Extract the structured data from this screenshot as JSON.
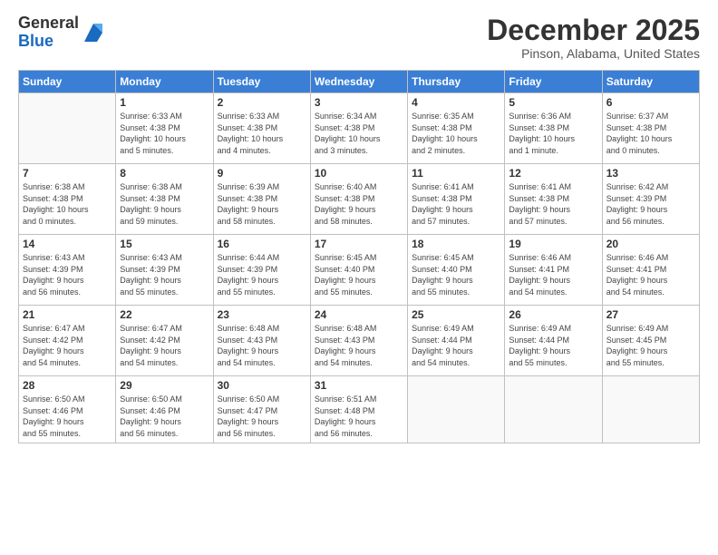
{
  "header": {
    "logo_general": "General",
    "logo_blue": "Blue",
    "month_title": "December 2025",
    "location": "Pinson, Alabama, United States"
  },
  "weekdays": [
    "Sunday",
    "Monday",
    "Tuesday",
    "Wednesday",
    "Thursday",
    "Friday",
    "Saturday"
  ],
  "weeks": [
    [
      {
        "day": "",
        "info": ""
      },
      {
        "day": "1",
        "info": "Sunrise: 6:33 AM\nSunset: 4:38 PM\nDaylight: 10 hours\nand 5 minutes."
      },
      {
        "day": "2",
        "info": "Sunrise: 6:33 AM\nSunset: 4:38 PM\nDaylight: 10 hours\nand 4 minutes."
      },
      {
        "day": "3",
        "info": "Sunrise: 6:34 AM\nSunset: 4:38 PM\nDaylight: 10 hours\nand 3 minutes."
      },
      {
        "day": "4",
        "info": "Sunrise: 6:35 AM\nSunset: 4:38 PM\nDaylight: 10 hours\nand 2 minutes."
      },
      {
        "day": "5",
        "info": "Sunrise: 6:36 AM\nSunset: 4:38 PM\nDaylight: 10 hours\nand 1 minute."
      },
      {
        "day": "6",
        "info": "Sunrise: 6:37 AM\nSunset: 4:38 PM\nDaylight: 10 hours\nand 0 minutes."
      }
    ],
    [
      {
        "day": "7",
        "info": "Sunrise: 6:38 AM\nSunset: 4:38 PM\nDaylight: 10 hours\nand 0 minutes."
      },
      {
        "day": "8",
        "info": "Sunrise: 6:38 AM\nSunset: 4:38 PM\nDaylight: 9 hours\nand 59 minutes."
      },
      {
        "day": "9",
        "info": "Sunrise: 6:39 AM\nSunset: 4:38 PM\nDaylight: 9 hours\nand 58 minutes."
      },
      {
        "day": "10",
        "info": "Sunrise: 6:40 AM\nSunset: 4:38 PM\nDaylight: 9 hours\nand 58 minutes."
      },
      {
        "day": "11",
        "info": "Sunrise: 6:41 AM\nSunset: 4:38 PM\nDaylight: 9 hours\nand 57 minutes."
      },
      {
        "day": "12",
        "info": "Sunrise: 6:41 AM\nSunset: 4:38 PM\nDaylight: 9 hours\nand 57 minutes."
      },
      {
        "day": "13",
        "info": "Sunrise: 6:42 AM\nSunset: 4:39 PM\nDaylight: 9 hours\nand 56 minutes."
      }
    ],
    [
      {
        "day": "14",
        "info": "Sunrise: 6:43 AM\nSunset: 4:39 PM\nDaylight: 9 hours\nand 56 minutes."
      },
      {
        "day": "15",
        "info": "Sunrise: 6:43 AM\nSunset: 4:39 PM\nDaylight: 9 hours\nand 55 minutes."
      },
      {
        "day": "16",
        "info": "Sunrise: 6:44 AM\nSunset: 4:39 PM\nDaylight: 9 hours\nand 55 minutes."
      },
      {
        "day": "17",
        "info": "Sunrise: 6:45 AM\nSunset: 4:40 PM\nDaylight: 9 hours\nand 55 minutes."
      },
      {
        "day": "18",
        "info": "Sunrise: 6:45 AM\nSunset: 4:40 PM\nDaylight: 9 hours\nand 55 minutes."
      },
      {
        "day": "19",
        "info": "Sunrise: 6:46 AM\nSunset: 4:41 PM\nDaylight: 9 hours\nand 54 minutes."
      },
      {
        "day": "20",
        "info": "Sunrise: 6:46 AM\nSunset: 4:41 PM\nDaylight: 9 hours\nand 54 minutes."
      }
    ],
    [
      {
        "day": "21",
        "info": "Sunrise: 6:47 AM\nSunset: 4:42 PM\nDaylight: 9 hours\nand 54 minutes."
      },
      {
        "day": "22",
        "info": "Sunrise: 6:47 AM\nSunset: 4:42 PM\nDaylight: 9 hours\nand 54 minutes."
      },
      {
        "day": "23",
        "info": "Sunrise: 6:48 AM\nSunset: 4:43 PM\nDaylight: 9 hours\nand 54 minutes."
      },
      {
        "day": "24",
        "info": "Sunrise: 6:48 AM\nSunset: 4:43 PM\nDaylight: 9 hours\nand 54 minutes."
      },
      {
        "day": "25",
        "info": "Sunrise: 6:49 AM\nSunset: 4:44 PM\nDaylight: 9 hours\nand 54 minutes."
      },
      {
        "day": "26",
        "info": "Sunrise: 6:49 AM\nSunset: 4:44 PM\nDaylight: 9 hours\nand 55 minutes."
      },
      {
        "day": "27",
        "info": "Sunrise: 6:49 AM\nSunset: 4:45 PM\nDaylight: 9 hours\nand 55 minutes."
      }
    ],
    [
      {
        "day": "28",
        "info": "Sunrise: 6:50 AM\nSunset: 4:46 PM\nDaylight: 9 hours\nand 55 minutes."
      },
      {
        "day": "29",
        "info": "Sunrise: 6:50 AM\nSunset: 4:46 PM\nDaylight: 9 hours\nand 56 minutes."
      },
      {
        "day": "30",
        "info": "Sunrise: 6:50 AM\nSunset: 4:47 PM\nDaylight: 9 hours\nand 56 minutes."
      },
      {
        "day": "31",
        "info": "Sunrise: 6:51 AM\nSunset: 4:48 PM\nDaylight: 9 hours\nand 56 minutes."
      },
      {
        "day": "",
        "info": ""
      },
      {
        "day": "",
        "info": ""
      },
      {
        "day": "",
        "info": ""
      }
    ]
  ]
}
